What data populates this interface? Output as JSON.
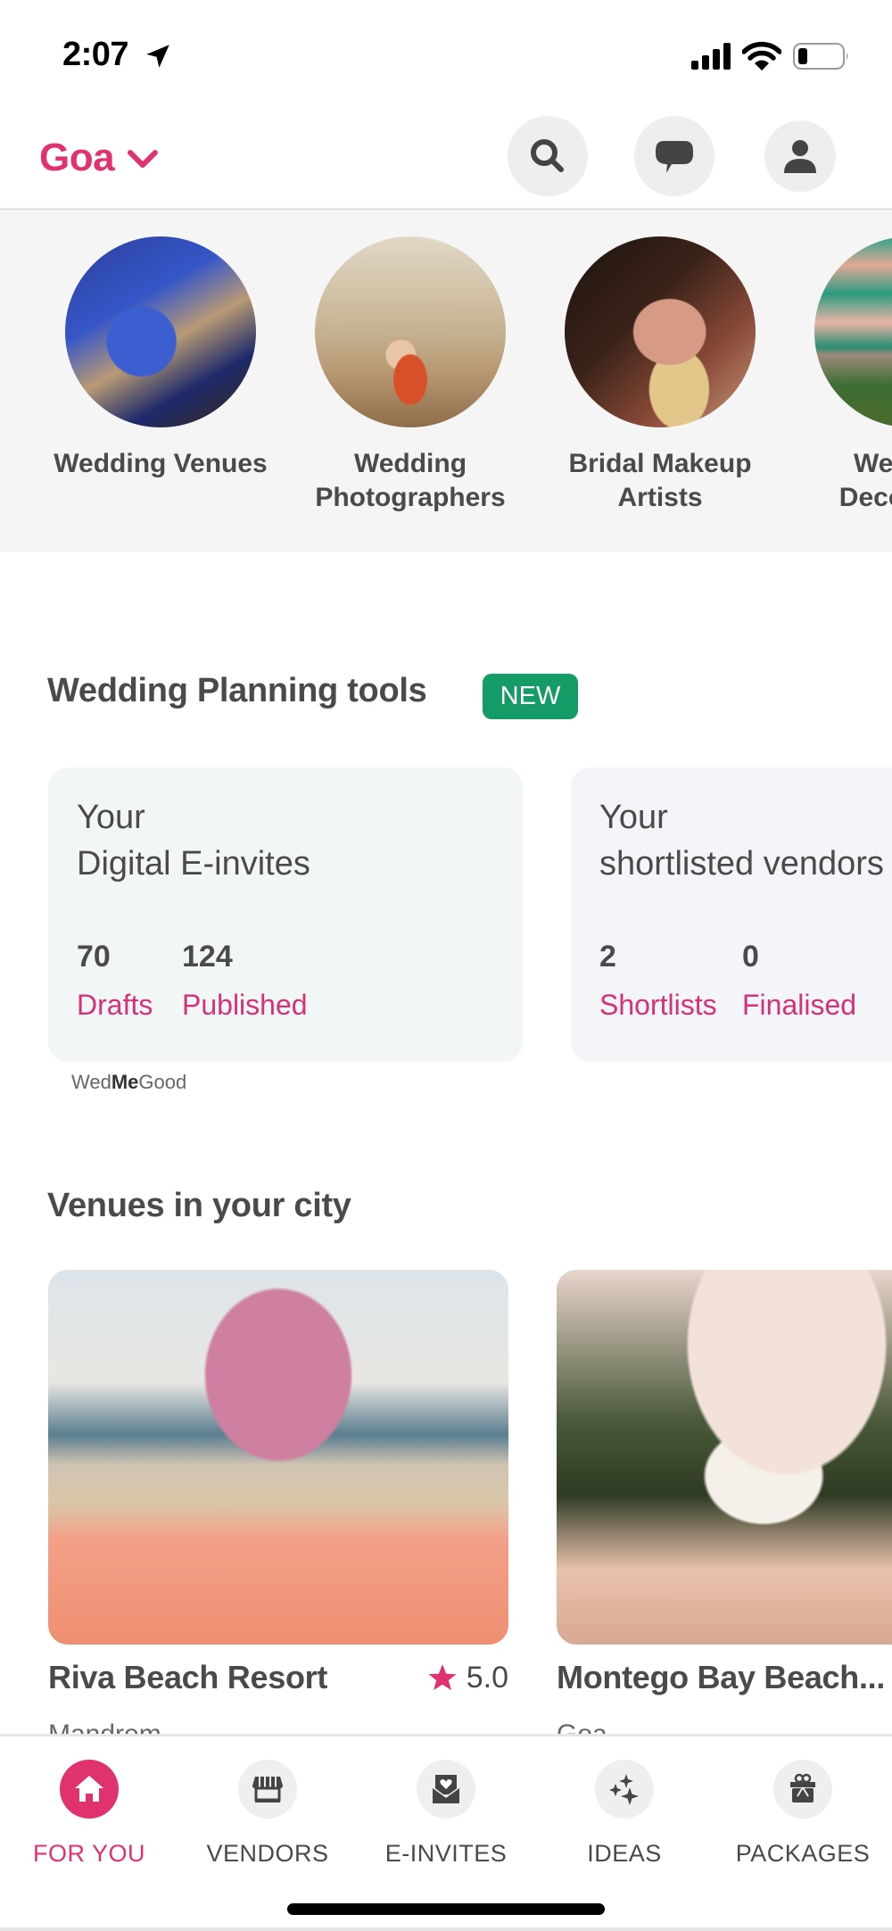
{
  "status_bar": {
    "time": "2:07",
    "battery_level_percent": 20
  },
  "header": {
    "city": "Goa",
    "icons": [
      "search-icon",
      "chat-icon",
      "profile-icon"
    ]
  },
  "categories": [
    {
      "label": "Wedding Venues",
      "icon": "venues-image"
    },
    {
      "label": "Wedding Photographers",
      "icon": "photographers-image"
    },
    {
      "label": "Bridal Makeup Artists",
      "icon": "makeup-image"
    },
    {
      "label": "Wedding Decorators",
      "icon": "decorators-image"
    }
  ],
  "planning_tools": {
    "title": "Wedding Planning tools",
    "badge": "NEW",
    "cards": [
      {
        "line1": "Your",
        "line2": "Digital E-invites",
        "stats": [
          {
            "value": "70",
            "label": "Drafts"
          },
          {
            "value": "124",
            "label": "Published"
          }
        ]
      },
      {
        "line1": "Your",
        "line2": "shortlisted vendors",
        "stats": [
          {
            "value": "2",
            "label": "Shortlists"
          },
          {
            "value": "0",
            "label": "Finalised"
          }
        ]
      }
    ],
    "brand_prefix": "Wed",
    "brand_bold": "Me",
    "brand_suffix": "Good"
  },
  "venues": {
    "title": "Venues in your city",
    "items": [
      {
        "name": "Riva Beach Resort",
        "rating": "5.0",
        "location": "Mandrem"
      },
      {
        "name": "Montego Bay Beach...",
        "rating": "",
        "location": "Goa"
      }
    ]
  },
  "bottom_nav": [
    {
      "label": "FOR YOU",
      "icon": "home-icon",
      "active": true
    },
    {
      "label": "VENDORS",
      "icon": "store-icon",
      "active": false
    },
    {
      "label": "E-INVITES",
      "icon": "invite-envelope-icon",
      "active": false
    },
    {
      "label": "IDEAS",
      "icon": "sparkles-icon",
      "active": false
    },
    {
      "label": "PACKAGES",
      "icon": "gift-icon",
      "active": false
    }
  ],
  "colors": {
    "brand_pink": "#e0326e",
    "stat_label_pink": "#d4317a",
    "new_badge_green": "#159b65",
    "text_dark": "#4a4a4a",
    "icon_circle_bg": "#eeeeee"
  }
}
